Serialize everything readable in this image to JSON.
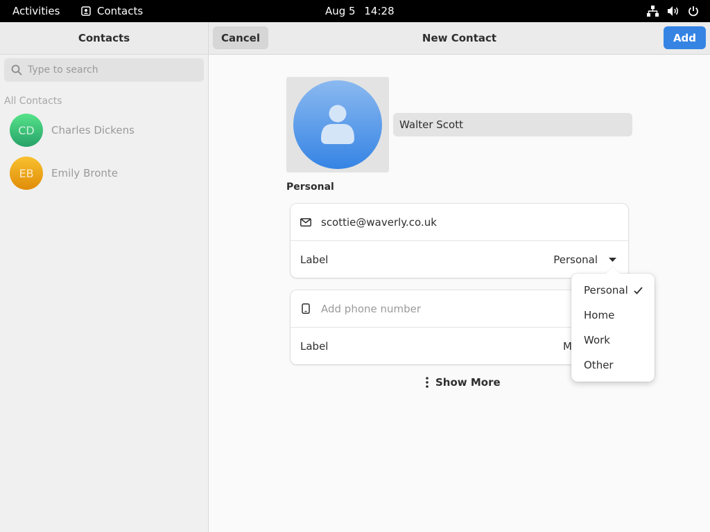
{
  "topbar": {
    "activities": "Activities",
    "app_name": "Contacts",
    "date": "Aug 5",
    "time": "14:28"
  },
  "sidebar": {
    "title": "Contacts",
    "search_placeholder": "Type to search",
    "section_title": "All Contacts",
    "contacts": [
      {
        "initials": "CD",
        "name": "Charles Dickens",
        "color": "#2ec27e"
      },
      {
        "initials": "EB",
        "name": "Emily Bronte",
        "color": "#e5a50a"
      }
    ]
  },
  "header": {
    "cancel_label": "Cancel",
    "title": "New Contact",
    "add_label": "Add"
  },
  "form": {
    "name_value": "Walter Scott",
    "group_title": "Personal",
    "email": {
      "value": "scottie@waverly.co.uk",
      "label": "Label",
      "label_value": "Personal"
    },
    "phone": {
      "placeholder": "Add phone number",
      "label": "Label",
      "label_value_partial": "M"
    },
    "show_more": "Show More"
  },
  "popover": {
    "options": [
      "Personal",
      "Home",
      "Work",
      "Other"
    ],
    "selected": "Personal"
  },
  "colors": {
    "accent": "#3584e4"
  }
}
